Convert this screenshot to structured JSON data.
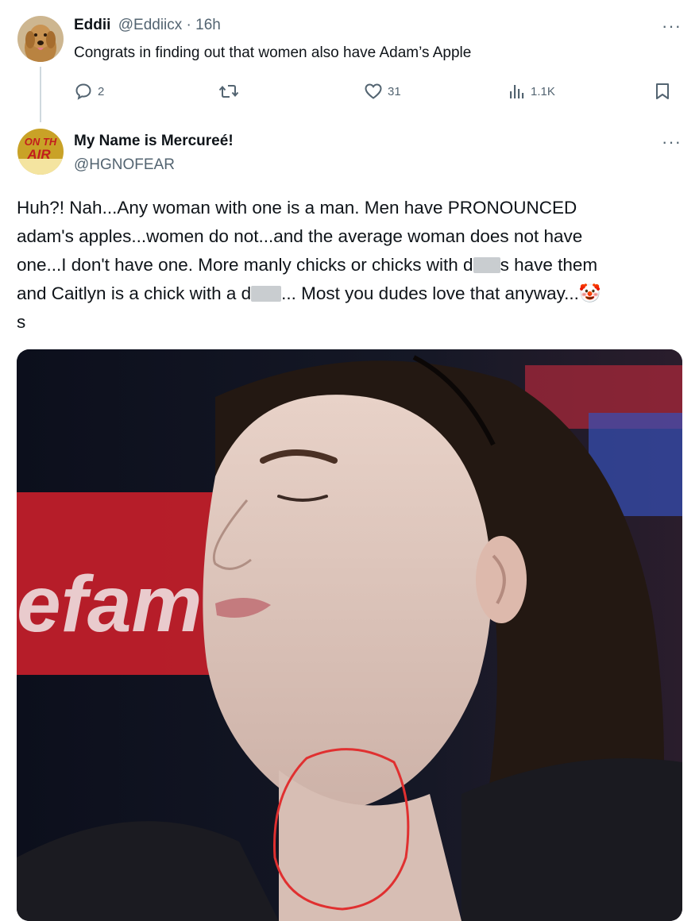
{
  "reply": {
    "display_name": "Eddii",
    "handle_time": "@Eddiicx · 16h",
    "text": "Congrats in finding out that women also have Adam’s Apple",
    "more": "···",
    "actions": {
      "replies": "2",
      "reposts": "",
      "likes": "31",
      "views": "1.1K"
    }
  },
  "post": {
    "display_name": "My Name is Mercureé!",
    "handle": "@HGNOFEAR",
    "more": "···",
    "avatar_text_top": "ON TH",
    "avatar_text_bottom": "AIR",
    "lines": [
      {
        "a": "Huh?! Nah...Any woman with one is a man. Men have PRONOUNCED"
      },
      {
        "a": "adam's apples...women do not...and the average woman does not have"
      },
      {
        "a": "one...I don't have one. More manly chicks or chicks with d",
        "b": "s have them"
      },
      {
        "a": "and Caitlyn is a chick with a d",
        "b": "... Most you dudes love that anyway...",
        "emoji": "🤡"
      },
      {
        "a": "s"
      }
    ],
    "media": {
      "sign_text": "efam",
      "annotation_color": "#e03030"
    }
  }
}
